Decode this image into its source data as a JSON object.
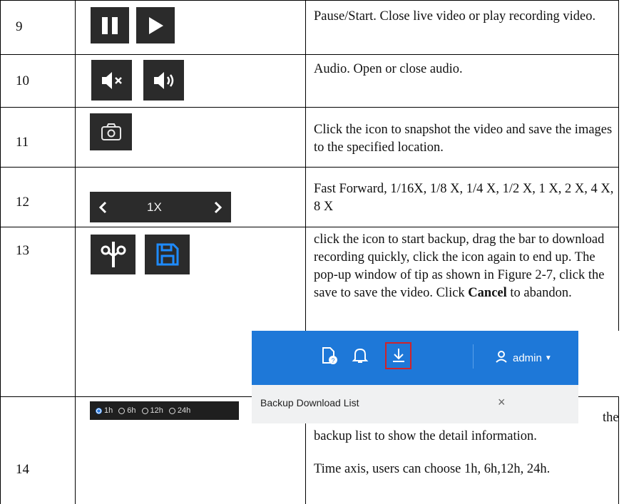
{
  "rows": [
    {
      "num": "9",
      "desc": "Pause/Start. Close live video or play recording video.",
      "icons": [
        "pause-icon",
        "play-icon"
      ]
    },
    {
      "num": "10",
      "desc": "Audio. Open or close audio.",
      "icons": [
        "mute-icon",
        "volume-icon"
      ]
    },
    {
      "num": "11",
      "desc": "Click the icon to snapshot the video and save the images to the specified location.",
      "icons": [
        "camera-icon"
      ]
    },
    {
      "num": "12",
      "desc": "Fast Forward, 1/16X, 1/8 X, 1/4 X, 1/2 X, 1 X, 2 X, 4 X, 8 X",
      "speed": "1X",
      "icons": [
        "chevron-left-icon",
        "chevron-right-icon"
      ]
    },
    {
      "num": "13",
      "desc_a": "click the icon to start backup, drag the bar to download recording quickly, click the icon again to end up. The pop-up window of tip as shown in Figure 2-7, click the save to save the video. Click ",
      "desc_bold": "Cancel",
      "desc_b": " to abandon.",
      "desc_c": "the",
      "desc_d": "backup list to show the detail information.",
      "icons": [
        "scissors-icon",
        "save-icon"
      ],
      "screenshot": {
        "user": "admin",
        "list_label": "Backup Download List",
        "close": "×",
        "icons": [
          "file-help-icon",
          "bell-icon",
          "download-icon",
          "user-icon",
          "caret-down-icon"
        ]
      }
    },
    {
      "num": "14",
      "desc": "Time axis, users can choose 1h, 6h,12h, 24h.",
      "options": [
        "1h",
        "6h",
        "12h",
        "24h"
      ],
      "selected": "1h"
    }
  ],
  "colors": {
    "icon_bg": "#2b2b2b",
    "accent_blue": "#1e78d8",
    "highlight_red": "#d0232a",
    "save_blue": "#1e8bff"
  }
}
